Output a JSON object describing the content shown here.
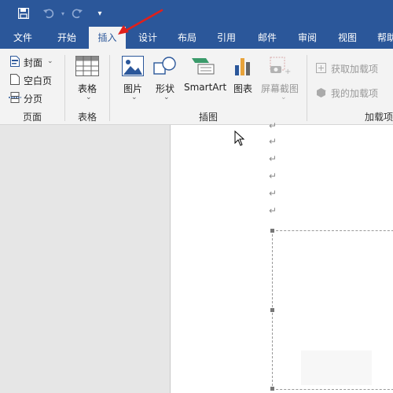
{
  "quick_access": {
    "save_icon": "save-icon",
    "undo_icon": "undo-icon",
    "redo_icon": "redo-icon",
    "customize_icon": "customize-arrow-icon"
  },
  "tabs": [
    {
      "label": "文件"
    },
    {
      "label": "开始"
    },
    {
      "label": "插入",
      "active": true
    },
    {
      "label": "设计"
    },
    {
      "label": "布局"
    },
    {
      "label": "引用"
    },
    {
      "label": "邮件"
    },
    {
      "label": "审阅"
    },
    {
      "label": "视图"
    },
    {
      "label": "帮助"
    }
  ],
  "ribbon": {
    "pages_group": {
      "name": "页面",
      "items": [
        {
          "label": "封面"
        },
        {
          "label": "空白页"
        },
        {
          "label": "分页"
        }
      ]
    },
    "table_group": {
      "name": "表格",
      "button": "表格"
    },
    "illustrations_group": {
      "name": "插图",
      "items": [
        {
          "label": "图片"
        },
        {
          "label": "形状"
        },
        {
          "label": "SmartArt"
        },
        {
          "label": "图表"
        },
        {
          "label": "屏幕截图",
          "disabled": true
        }
      ]
    },
    "addins_group": {
      "name": "加载项",
      "items": [
        {
          "label": "获取加载项",
          "disabled": true
        },
        {
          "label": "我的加载项",
          "disabled": true
        }
      ]
    }
  },
  "colors": {
    "title_bar": "#2b579a",
    "ribbon_bg": "#f3f3f3",
    "annotation_arrow": "#e0201b"
  }
}
